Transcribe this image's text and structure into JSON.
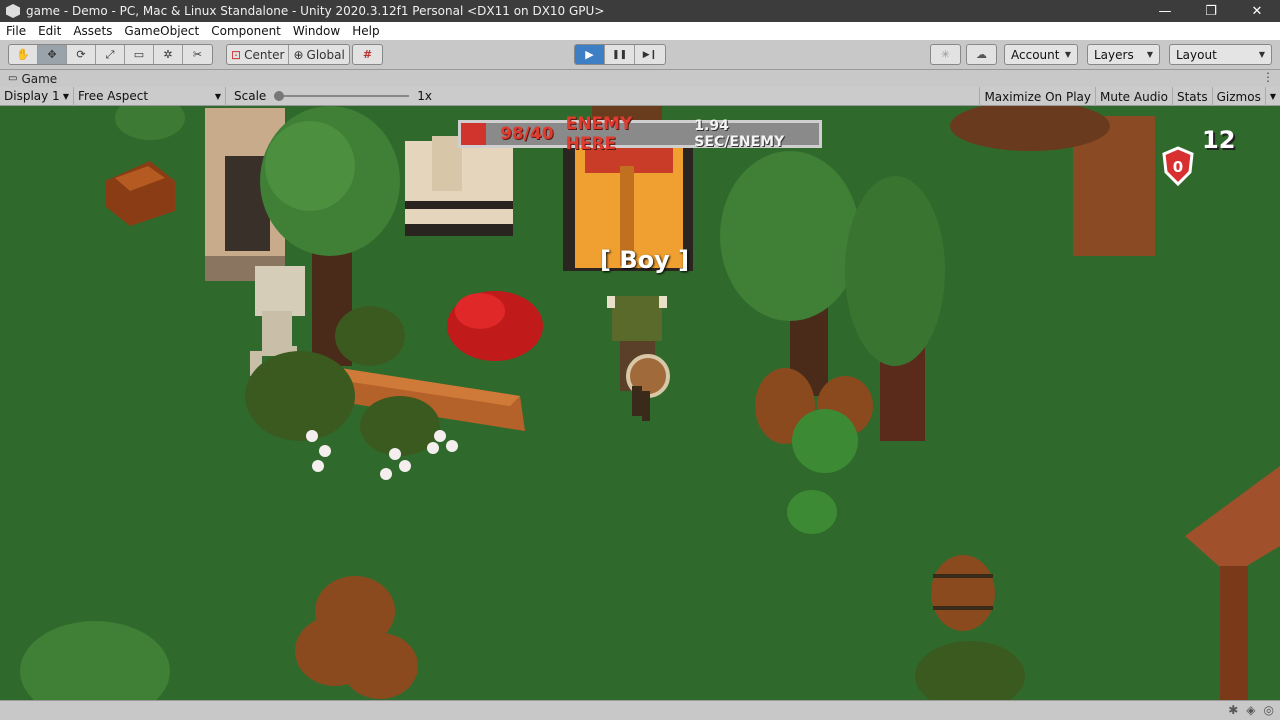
{
  "window": {
    "title": "game - Demo - PC, Mac & Linux Standalone - Unity 2020.3.12f1 Personal <DX11 on DX10 GPU>",
    "controls": {
      "minimize": "—",
      "maximize": "❐",
      "close": "✕"
    }
  },
  "menu": [
    "File",
    "Edit",
    "Assets",
    "GameObject",
    "Component",
    "Window",
    "Help"
  ],
  "toolbar": {
    "tools": [
      {
        "name": "hand-tool",
        "glyph": "✋"
      },
      {
        "name": "move-tool",
        "glyph": "✥"
      },
      {
        "name": "rotate-tool",
        "glyph": "⟳"
      },
      {
        "name": "scale-tool",
        "glyph": "⤢"
      },
      {
        "name": "rect-tool",
        "glyph": "▭"
      },
      {
        "name": "transform-tool",
        "glyph": "✲"
      },
      {
        "name": "custom-tool",
        "glyph": "✂"
      }
    ],
    "pivot_label": "Center",
    "space_label": "Global",
    "grid_glyph": "#",
    "play_glyph": "▶",
    "pause_glyph": "❚❚",
    "step_glyph": "▶❙",
    "collab_glyph": "✳",
    "cloud_glyph": "☁",
    "account_label": "Account",
    "layers_label": "Layers",
    "layout_label": "Layout"
  },
  "tab": {
    "label": "Game",
    "kebab": "⋮"
  },
  "gamebar": {
    "display": "Display 1",
    "aspect": "Free Aspect",
    "scale_label": "Scale",
    "scale_value": "1x",
    "maximize": "Maximize On Play",
    "mute": "Mute Audio",
    "stats": "Stats",
    "gizmos": "Gizmos"
  },
  "hud": {
    "count": "98/40",
    "enemy_text": "ENEMY HERE",
    "rate": "1.94 SEC/ENEMY",
    "player_label": "[ Boy ]",
    "shield_value": "0",
    "score": "12"
  },
  "colors": {
    "grass": "#2f6a2c",
    "play_active": "#3d7ec4",
    "hud_red": "#e03b2e"
  }
}
